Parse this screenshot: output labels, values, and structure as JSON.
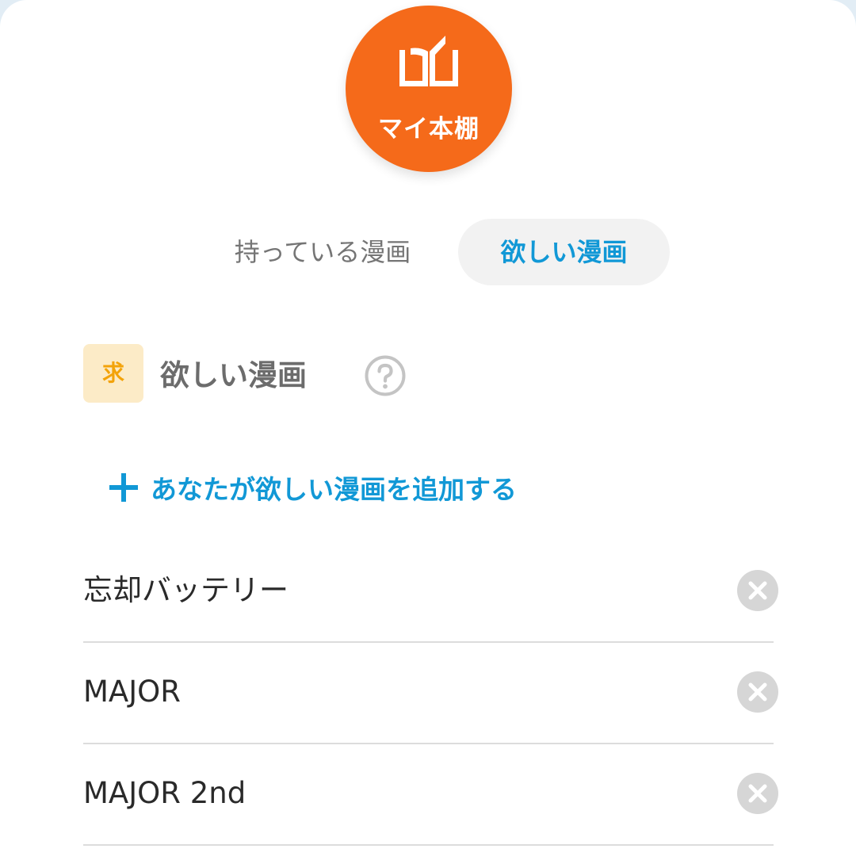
{
  "header": {
    "badge_label": "マイ本棚",
    "icon": "open-book-icon",
    "accent_color": "#f56a1a"
  },
  "tabs": [
    {
      "label": "持っている漫画",
      "active": false
    },
    {
      "label": "欲しい漫画",
      "active": true
    }
  ],
  "section": {
    "tag": "求",
    "title": "欲しい漫画",
    "help_icon": "question-circle-icon"
  },
  "add_link": {
    "label": "あなたが欲しい漫画を追加する",
    "icon": "plus-icon"
  },
  "wanted_list": [
    {
      "title": "忘却バッテリー",
      "action_icon": "remove-circle-icon"
    },
    {
      "title": "MAJOR",
      "action_icon": "remove-circle-icon"
    },
    {
      "title": "MAJOR 2nd",
      "action_icon": "remove-circle-icon"
    }
  ],
  "colors": {
    "link_blue": "#1198d6",
    "tag_background": "#fcebc7",
    "tag_text": "#f3a30a"
  }
}
